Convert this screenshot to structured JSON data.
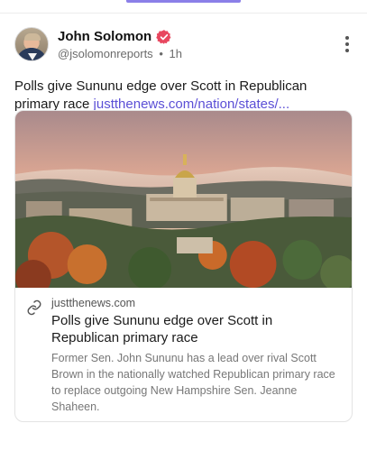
{
  "author": {
    "name": "John Solomon",
    "handle": "@jsolomonreports",
    "separator": "•",
    "time": "1h"
  },
  "post": {
    "text": "Polls give Sununu edge over Scott in Republican primary race ",
    "link_text": "justthenews.com/nation/states/..."
  },
  "card": {
    "domain": "justthenews.com",
    "title": "Polls give Sununu edge over Scott in Republican primary race",
    "description": "Former Sen. John Sununu has a lead over rival Scott Brown in the nationally watched Republican primary race to replace outgoing New Hampshire Sen. Jeanne Shaheen."
  },
  "colors": {
    "accent": "#5b4fd6",
    "verified_badge": "#e8475f",
    "tab_indicator": "#8b7fe8"
  },
  "icons": {
    "verified": "verified-badge-icon",
    "more": "more-vertical-icon",
    "link": "link-icon"
  }
}
